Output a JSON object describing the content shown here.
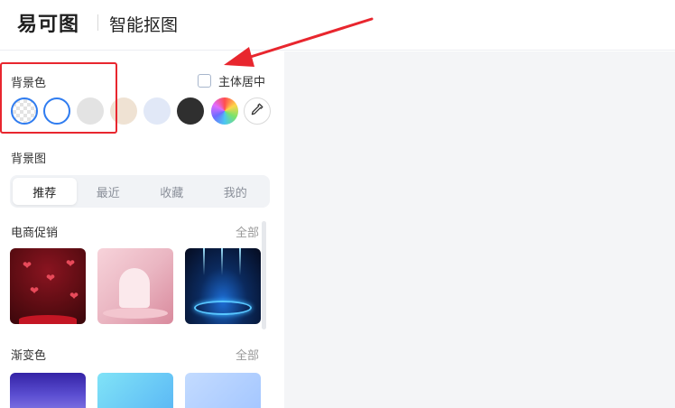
{
  "header": {
    "logo_text": "易可图",
    "app_title": "智能抠图"
  },
  "background_color": {
    "label": "背景色",
    "center_subject_label": "主体居中",
    "swatches": [
      {
        "name": "transparent"
      },
      {
        "name": "white",
        "color": "#ffffff"
      },
      {
        "name": "light-gray",
        "color": "#e3e3e3"
      },
      {
        "name": "beige",
        "color": "#efe2d3"
      },
      {
        "name": "light-blue",
        "color": "#e1e8f7"
      },
      {
        "name": "dark-gray",
        "color": "#2f2f2f"
      },
      {
        "name": "color-wheel"
      }
    ],
    "picker_icon": "eyedropper-icon"
  },
  "background_image": {
    "label": "背景图",
    "tabs": [
      "推荐",
      "最近",
      "收藏",
      "我的"
    ],
    "active_tab": "推荐"
  },
  "ecommerce": {
    "label": "电商促销",
    "more": "全部"
  },
  "gradient": {
    "label": "渐变色",
    "more": "全部"
  },
  "colors": {
    "accent": "#2f7cf0",
    "annotation": "#e8262e"
  }
}
